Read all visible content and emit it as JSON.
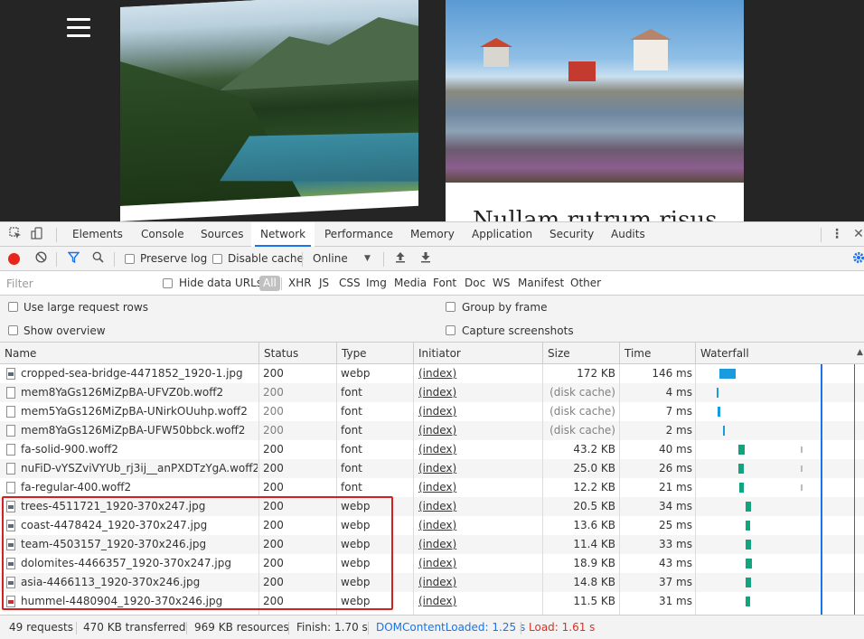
{
  "page": {
    "headline": "Nullam rutrum risus"
  },
  "devtools": {
    "tabs": [
      "Elements",
      "Console",
      "Sources",
      "Network",
      "Performance",
      "Memory",
      "Application",
      "Security",
      "Audits"
    ],
    "active_tab": "Network",
    "toolbar": {
      "preserve_log": "Preserve log",
      "disable_cache": "Disable cache",
      "throttle": "Online"
    },
    "filter": {
      "placeholder": "Filter",
      "hide_data_urls": "Hide data URLs",
      "types": [
        "All",
        "XHR",
        "JS",
        "CSS",
        "Img",
        "Media",
        "Font",
        "Doc",
        "WS",
        "Manifest",
        "Other"
      ]
    },
    "options": {
      "large_rows": "Use large request rows",
      "group_by_frame": "Group by frame",
      "show_overview": "Show overview",
      "capture_screenshots": "Capture screenshots"
    },
    "columns": [
      "Name",
      "Status",
      "Type",
      "Initiator",
      "Size",
      "Time",
      "Waterfall"
    ],
    "requests": [
      {
        "name": "cropped-sea-bridge-4471852_1920-1.jpg",
        "status": "200",
        "type": "webp",
        "initiator": "(index)",
        "size": "172 KB",
        "time": "146 ms",
        "icon": "image-file-icon",
        "wf_start": 0.24,
        "wf_len": 0.03,
        "wf_color": "#1a9be0"
      },
      {
        "name": "mem8YaGs126MiZpBA-UFVZ0b.woff2",
        "status": "200",
        "type": "font",
        "initiator": "(index)",
        "size": "(disk cache)",
        "time": "4 ms",
        "icon": "file-icon",
        "wf_start": 0.235,
        "wf_len": 0.004,
        "wf_color": "#1a9be0"
      },
      {
        "name": "mem5YaGs126MiZpBA-UNirkOUuhp.woff2",
        "status": "200",
        "type": "font",
        "initiator": "(index)",
        "size": "(disk cache)",
        "time": "7 ms",
        "icon": "file-icon",
        "wf_start": 0.237,
        "wf_len": 0.005,
        "wf_color": "#1a9be0"
      },
      {
        "name": "mem8YaGs126MiZpBA-UFW50bbck.woff2",
        "status": "200",
        "type": "font",
        "initiator": "(index)",
        "size": "(disk cache)",
        "time": "2 ms",
        "icon": "file-icon",
        "wf_start": 0.248,
        "wf_len": 0.004,
        "wf_color": "#1a9be0"
      },
      {
        "name": "fa-solid-900.woff2",
        "status": "200",
        "type": "font",
        "initiator": "(index)",
        "size": "43.2 KB",
        "time": "40 ms",
        "icon": "file-icon",
        "wf_start": 0.275,
        "wf_len": 0.012,
        "wf_color": "#14a37f"
      },
      {
        "name": "nuFiD-vYSZviVYUb_rj3ij__anPXDTzYgA.woff2",
        "status": "200",
        "type": "font",
        "initiator": "(index)",
        "size": "25.0 KB",
        "time": "26 ms",
        "icon": "file-icon",
        "wf_start": 0.276,
        "wf_len": 0.01,
        "wf_color": "#14a37f"
      },
      {
        "name": "fa-regular-400.woff2",
        "status": "200",
        "type": "font",
        "initiator": "(index)",
        "size": "12.2 KB",
        "time": "21 ms",
        "icon": "file-icon",
        "wf_start": 0.277,
        "wf_len": 0.008,
        "wf_color": "#14a37f"
      },
      {
        "name": "trees-4511721_1920-370x247.jpg",
        "status": "200",
        "type": "webp",
        "initiator": "(index)",
        "size": "20.5 KB",
        "time": "34 ms",
        "icon": "image-file-icon",
        "wf_start": 0.29,
        "wf_len": 0.01,
        "wf_color": "#14a37f"
      },
      {
        "name": "coast-4478424_1920-370x247.jpg",
        "status": "200",
        "type": "webp",
        "initiator": "(index)",
        "size": "13.6 KB",
        "time": "25 ms",
        "icon": "image-file-icon",
        "wf_start": 0.29,
        "wf_len": 0.008,
        "wf_color": "#14a37f"
      },
      {
        "name": "team-4503157_1920-370x246.jpg",
        "status": "200",
        "type": "webp",
        "initiator": "(index)",
        "size": "11.4 KB",
        "time": "33 ms",
        "icon": "image-file-icon",
        "wf_start": 0.29,
        "wf_len": 0.01,
        "wf_color": "#14a37f"
      },
      {
        "name": "dolomites-4466357_1920-370x247.jpg",
        "status": "200",
        "type": "webp",
        "initiator": "(index)",
        "size": "18.9 KB",
        "time": "43 ms",
        "icon": "image-file-icon",
        "wf_start": 0.29,
        "wf_len": 0.012,
        "wf_color": "#14a37f"
      },
      {
        "name": "asia-4466113_1920-370x246.jpg",
        "status": "200",
        "type": "webp",
        "initiator": "(index)",
        "size": "14.8 KB",
        "time": "37 ms",
        "icon": "image-file-icon",
        "wf_start": 0.29,
        "wf_len": 0.01,
        "wf_color": "#14a37f"
      },
      {
        "name": "hummel-4480904_1920-370x246.jpg",
        "status": "200",
        "type": "webp",
        "initiator": "(index)",
        "size": "11.5 KB",
        "time": "31 ms",
        "icon": "image-file-icon-red",
        "wf_start": 0.29,
        "wf_len": 0.009,
        "wf_color": "#14a37f"
      }
    ],
    "status": {
      "requests": "49 requests",
      "transferred": "470 KB transferred",
      "resources": "969 KB resources",
      "finish": "Finish: 1.70 s",
      "dom_content_loaded": "DOMContentLoaded: 1.25 s",
      "load": "Load: 1.61 s"
    },
    "colors": {
      "dcl_line": "#1a73e8",
      "load_line": "#d93025",
      "highlight": "#d32121"
    }
  }
}
